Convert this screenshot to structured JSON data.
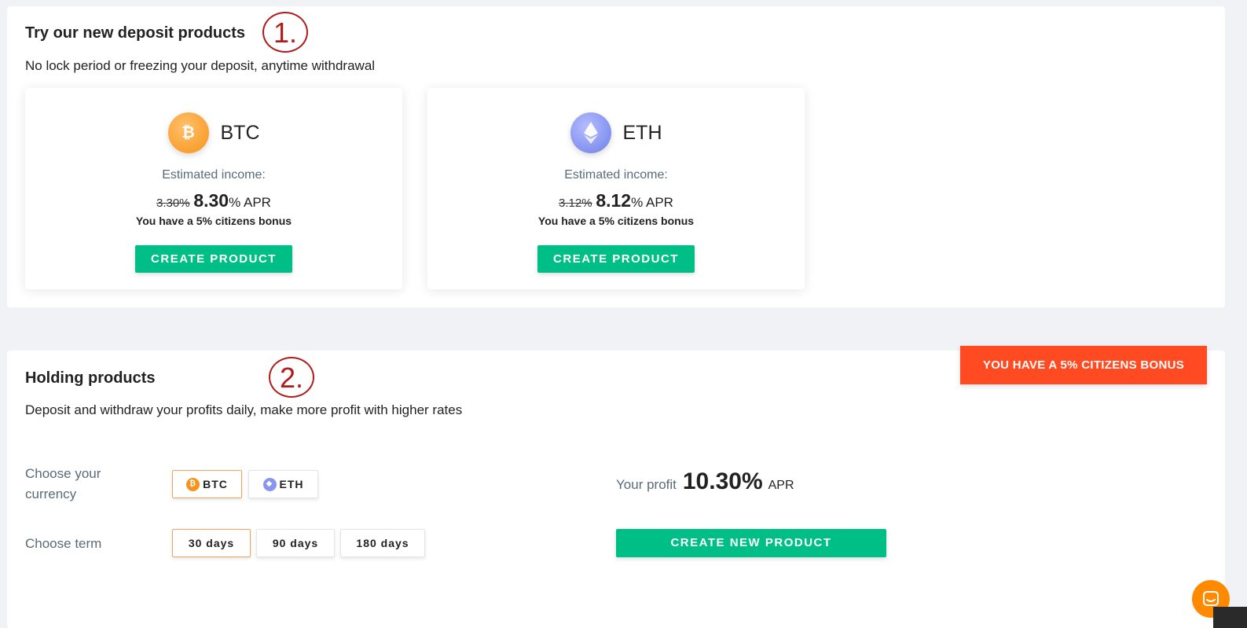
{
  "section1": {
    "title": "Try our new deposit products",
    "annotation": "1.",
    "subtitle": "No lock period or freezing your deposit, anytime withdrawal",
    "products": [
      {
        "coin": "BTC",
        "coin_symbol": "₿",
        "icon": "bitcoin-icon",
        "estimated_label": "Estimated income:",
        "old_rate": "3.30%",
        "new_rate": "8.30",
        "rate_suffix": "% APR",
        "bonus_text": "You have a 5% citizens bonus",
        "button_label": "CREATE PRODUCT"
      },
      {
        "coin": "ETH",
        "coin_symbol": "◆",
        "icon": "ethereum-icon",
        "estimated_label": "Estimated income:",
        "old_rate": "3.12%",
        "new_rate": "8.12",
        "rate_suffix": "% APR",
        "bonus_text": "You have a 5% citizens bonus",
        "button_label": "CREATE PRODUCT"
      }
    ]
  },
  "section2": {
    "title": "Holding products",
    "annotation": "2.",
    "subtitle": "Deposit and withdraw your profits daily, make more profit with higher rates",
    "badge": "YOU HAVE A 5% CITIZENS BONUS",
    "currency_label_line1": "Choose your",
    "currency_label_line2": "currency",
    "currencies": [
      {
        "label": "BTC",
        "symbol": "₿",
        "active": true
      },
      {
        "label": "ETH",
        "symbol": "◆",
        "active": false
      }
    ],
    "term_label": "Choose term",
    "terms": [
      {
        "label": "30 days",
        "active": true
      },
      {
        "label": "90 days",
        "active": false
      },
      {
        "label": "180 days",
        "active": false
      }
    ],
    "profit_label": "Your profit",
    "profit_value": "10.30%",
    "profit_unit": "APR",
    "create_button": "CREATE NEW PRODUCT"
  },
  "colors": {
    "accent_green": "#00bf86",
    "badge_red": "#ff4a22",
    "annotation_red": "#b01c1c",
    "chat_orange": "#ff8a00"
  }
}
